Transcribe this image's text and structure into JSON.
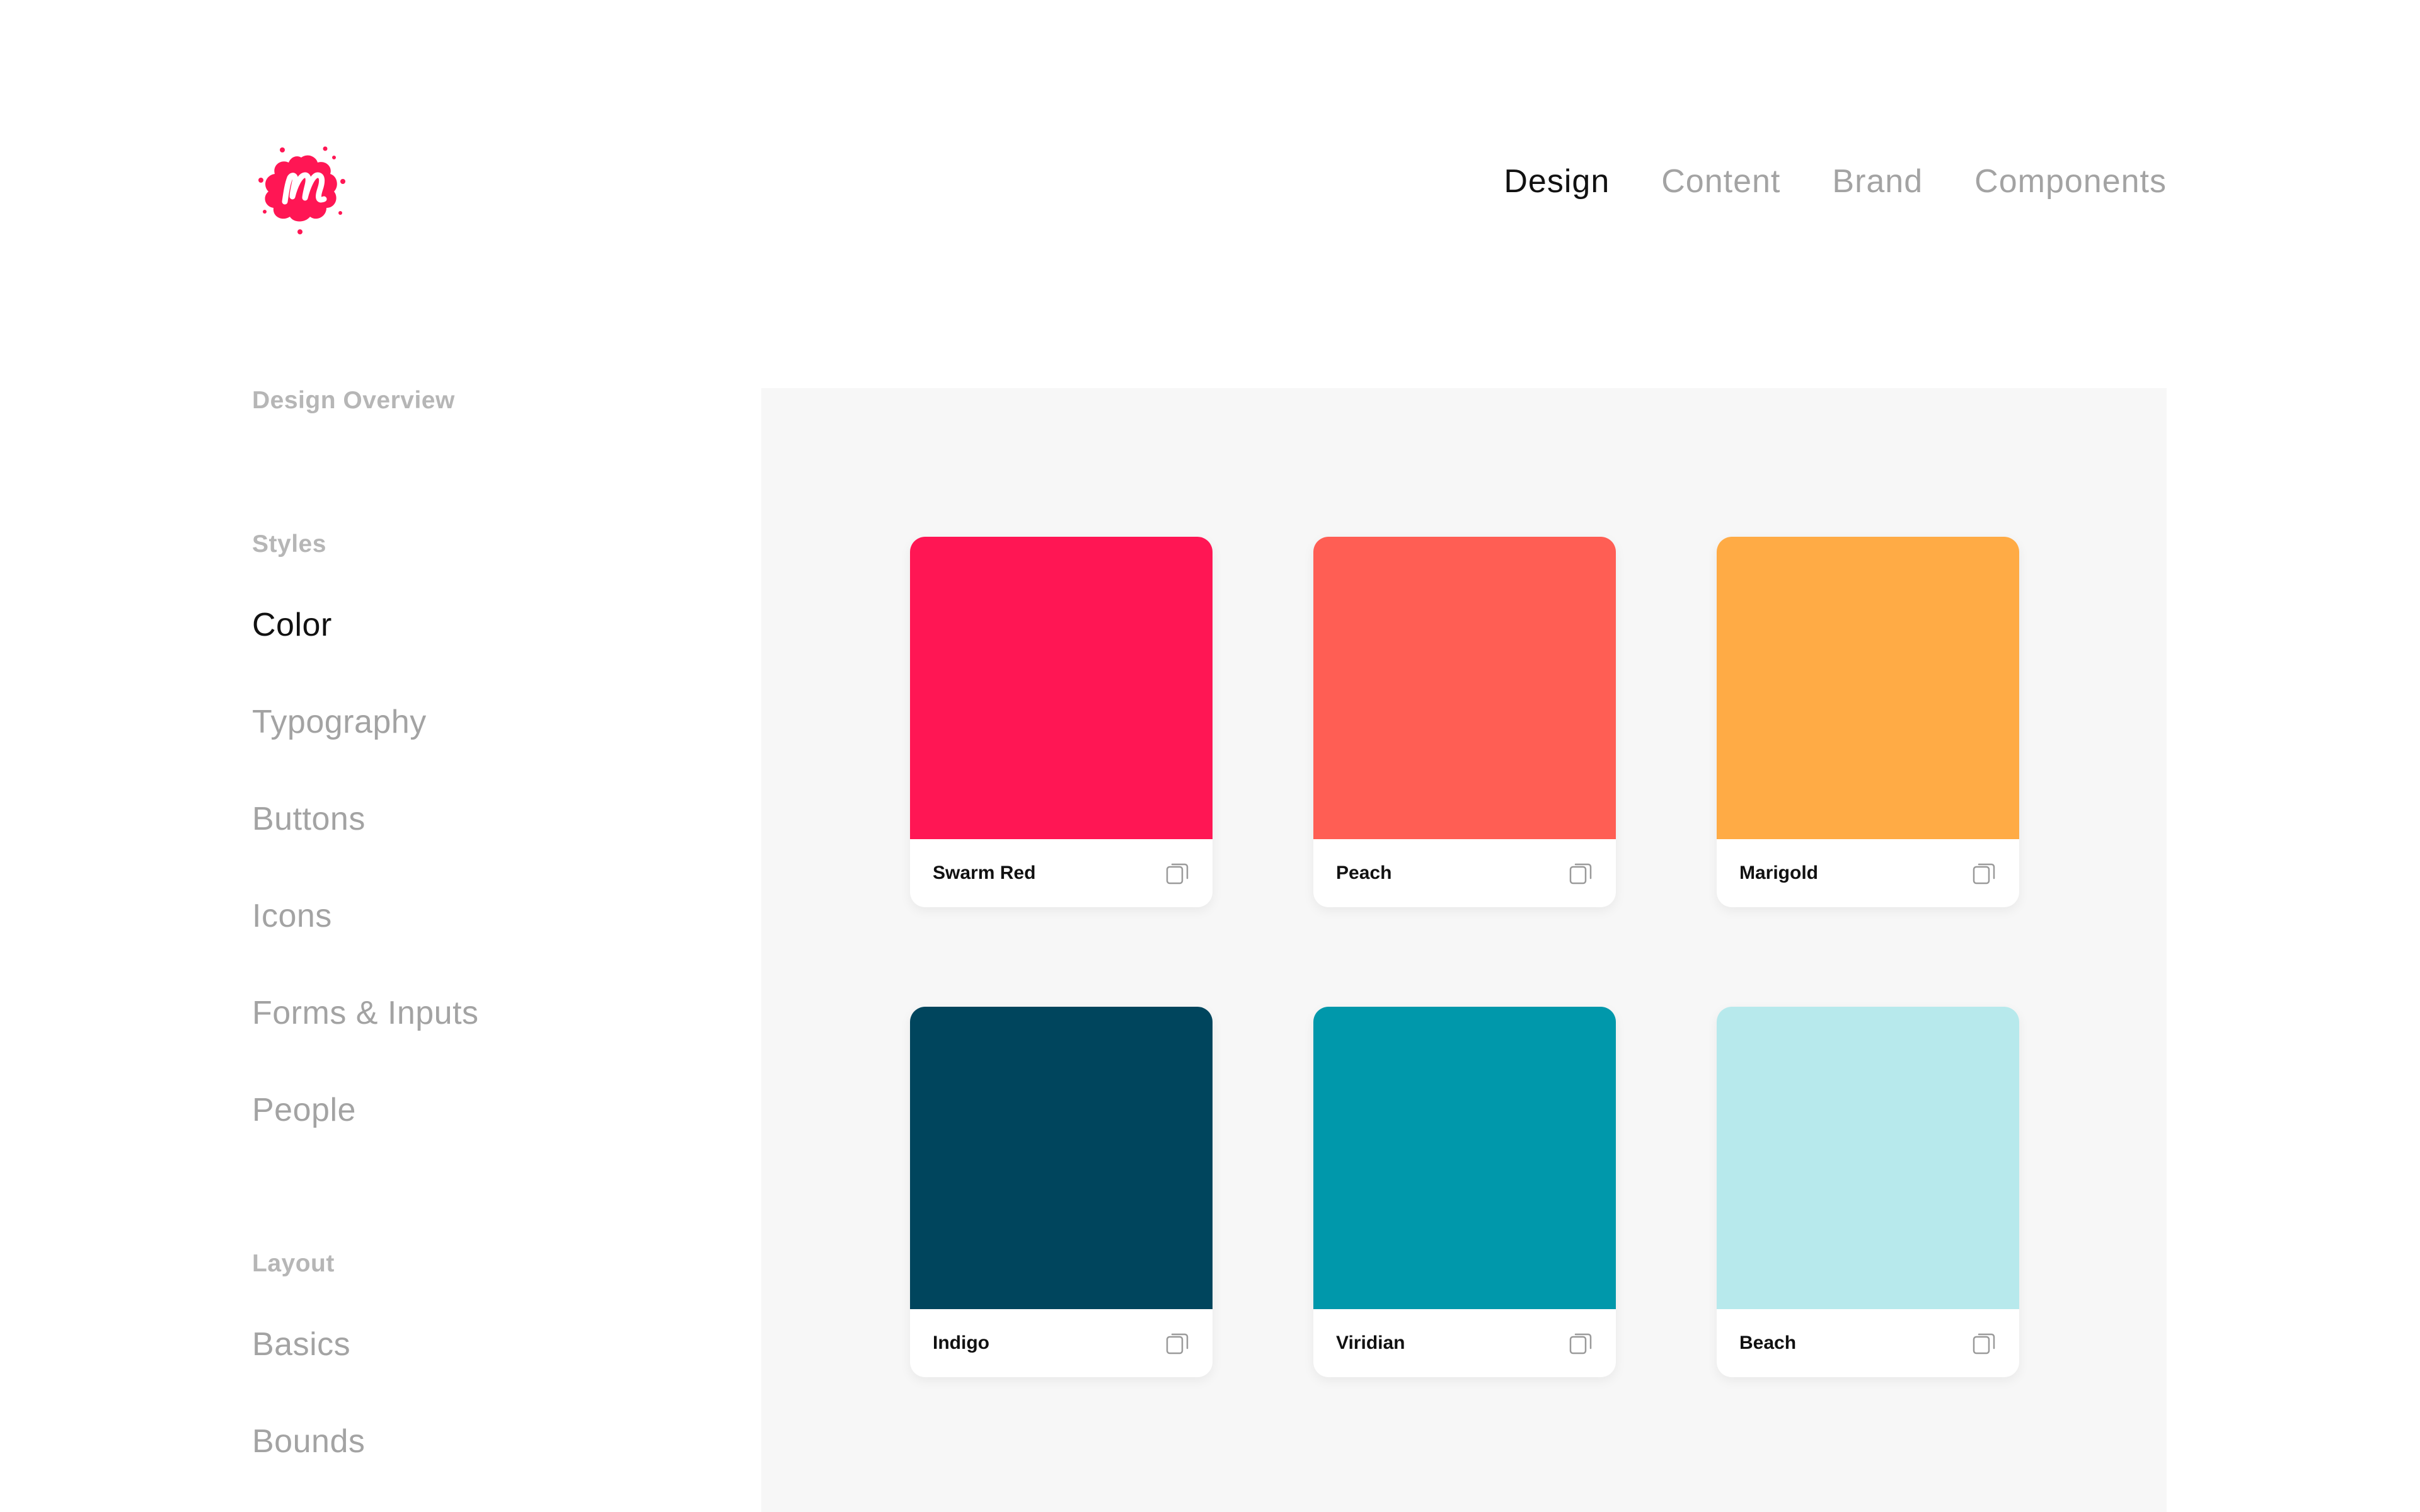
{
  "nav": {
    "items": [
      {
        "label": "Design",
        "active": true
      },
      {
        "label": "Content",
        "active": false
      },
      {
        "label": "Brand",
        "active": false
      },
      {
        "label": "Components",
        "active": false
      }
    ]
  },
  "sidebar": {
    "overview": "Design Overview",
    "styles_title": "Styles",
    "styles": [
      {
        "label": "Color",
        "active": true
      },
      {
        "label": "Typography",
        "active": false
      },
      {
        "label": "Buttons",
        "active": false
      },
      {
        "label": "Icons",
        "active": false
      },
      {
        "label": "Forms & Inputs",
        "active": false
      },
      {
        "label": "People",
        "active": false
      }
    ],
    "layout_title": "Layout",
    "layout": [
      {
        "label": "Basics",
        "active": false
      },
      {
        "label": "Bounds",
        "active": false
      }
    ]
  },
  "swatches": [
    {
      "name": "Swarm Red",
      "color": "#FF1654",
      "icon": "copy-icon"
    },
    {
      "name": "Peach",
      "color": "#FF5E54",
      "icon": "copy-icon"
    },
    {
      "name": "Marigold",
      "color": "#FFAB45",
      "icon": "copy-icon"
    },
    {
      "name": "Indigo",
      "color": "#00455D",
      "icon": "copy-icon"
    },
    {
      "name": "Viridian",
      "color": "#0098AB",
      "icon": "copy-icon"
    },
    {
      "name": "Beach",
      "color": "#B7E9EC",
      "icon": "copy-icon"
    }
  ],
  "brand": {
    "logo_color": "#FF1654",
    "logo_icon": "meetup-logo-icon"
  }
}
